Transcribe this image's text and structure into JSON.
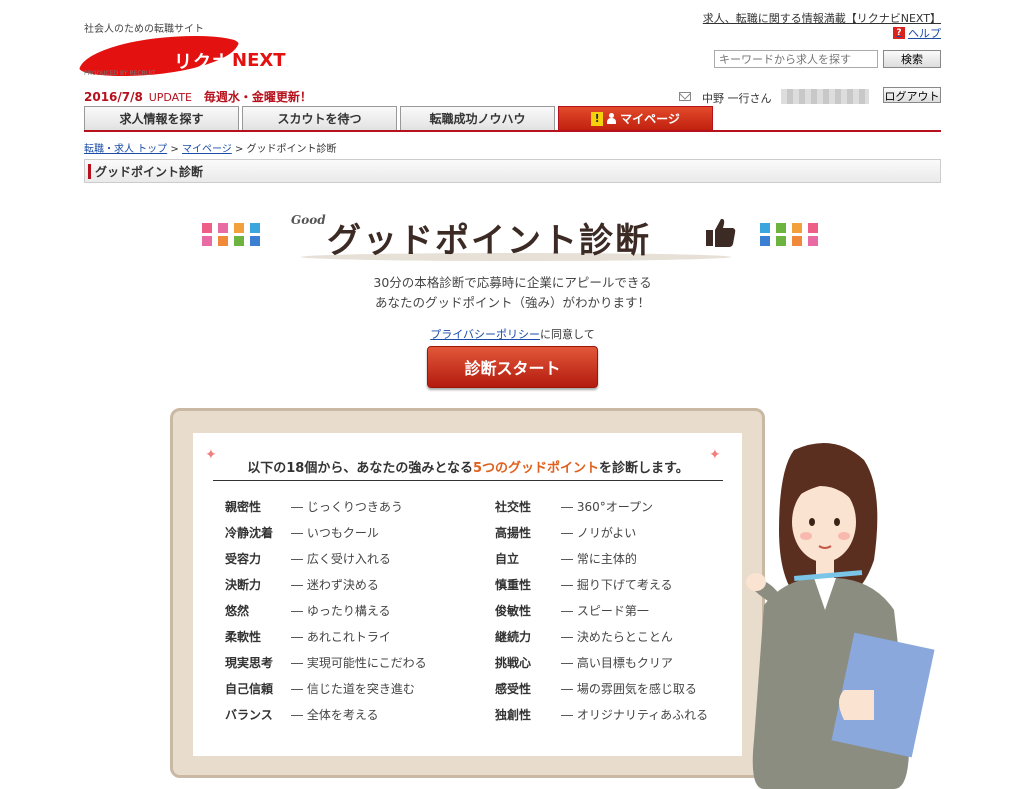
{
  "header": {
    "tagline": "社会人のための転職サイト",
    "logo_main": "リクナビ",
    "logo_next": "NEXT",
    "logo_produced": "PRODUCED BY RECRUIT",
    "top_link": "求人、転職に関する情報満載【リクナビNEXT】",
    "help_label": "ヘルプ",
    "search_placeholder": "キーワードから求人を探す",
    "search_button": "検索",
    "date": "2016/7/8",
    "update_label": "UPDATE",
    "weekly_label": "毎週水・金曜更新！",
    "user_name": "中野 一行さん",
    "logout_button": "ログアウト"
  },
  "tabs": [
    {
      "label": "求人情報を探す"
    },
    {
      "label": "スカウトを待つ"
    },
    {
      "label": "転職成功ノウハウ"
    },
    {
      "label": "マイページ",
      "active": true
    }
  ],
  "breadcrumb": {
    "items": [
      "転職・求人 トップ",
      "マイページ"
    ],
    "current": "グッドポイント診断",
    "sep": ">"
  },
  "section_title": "グッドポイント診断",
  "hero": {
    "good_label": "Good",
    "title": "グッドポイント診断",
    "desc_line1": "30分の本格診断で応募時に企業にアピールできる",
    "desc_line2": "あなたのグッドポイント（強み）がわかります！",
    "privacy_link": "プライバシーポリシー",
    "privacy_suffix": "に同意して",
    "start_button": "診断スタート"
  },
  "board": {
    "heading_prefix": "以下の18個から、あなたの強みとなる",
    "heading_accent": "5つのグッドポイント",
    "heading_suffix": "を診断します。",
    "left_traits": [
      {
        "name": "親密性",
        "desc": "― じっくりつきあう"
      },
      {
        "name": "冷静沈着",
        "desc": "― いつもクール"
      },
      {
        "name": "受容力",
        "desc": "― 広く受け入れる"
      },
      {
        "name": "決断力",
        "desc": "― 迷わず決める"
      },
      {
        "name": "悠然",
        "desc": "― ゆったり構える"
      },
      {
        "name": "柔軟性",
        "desc": "― あれこれトライ"
      },
      {
        "name": "現実思考",
        "desc": "― 実現可能性にこだわる"
      },
      {
        "name": "自己信頼",
        "desc": "― 信じた道を突き進む"
      },
      {
        "name": "バランス",
        "desc": "― 全体を考える"
      }
    ],
    "right_traits": [
      {
        "name": "社交性",
        "desc": "― 360°オープン"
      },
      {
        "name": "高揚性",
        "desc": "― ノリがよい"
      },
      {
        "name": "自立",
        "desc": "― 常に主体的"
      },
      {
        "name": "慎重性",
        "desc": "― 掘り下げて考える"
      },
      {
        "name": "俊敏性",
        "desc": "― スピード第一"
      },
      {
        "name": "継続力",
        "desc": "― 決めたらとことん"
      },
      {
        "name": "挑戦心",
        "desc": "― 高い目標もクリア"
      },
      {
        "name": "感受性",
        "desc": "― 場の雰囲気を感じ取る"
      },
      {
        "name": "独創性",
        "desc": "― オリジナリティあふれる"
      }
    ]
  },
  "colors": {
    "brand_red": "#e3110f",
    "dark_red": "#b6111c",
    "accent_orange": "#e0601e",
    "link_blue": "#1b4da8",
    "square_colors_left": [
      "#ee5e86",
      "#e96ba3",
      "#f2a03b",
      "#3aa6dd",
      "#e96ba3",
      "#f08a3a",
      "#6cb33f",
      "#3a7fd1"
    ],
    "square_colors_right": [
      "#3aa6dd",
      "#6cb33f",
      "#f2a03b",
      "#ee5e86",
      "#3a7fd1",
      "#6cb33f",
      "#f08a3a",
      "#e96ba3"
    ]
  },
  "icons": {
    "help": "question-icon",
    "mail": "mail-icon",
    "notice": "exclamation-icon",
    "person": "person-icon",
    "thumb": "thumbs-up-icon"
  }
}
